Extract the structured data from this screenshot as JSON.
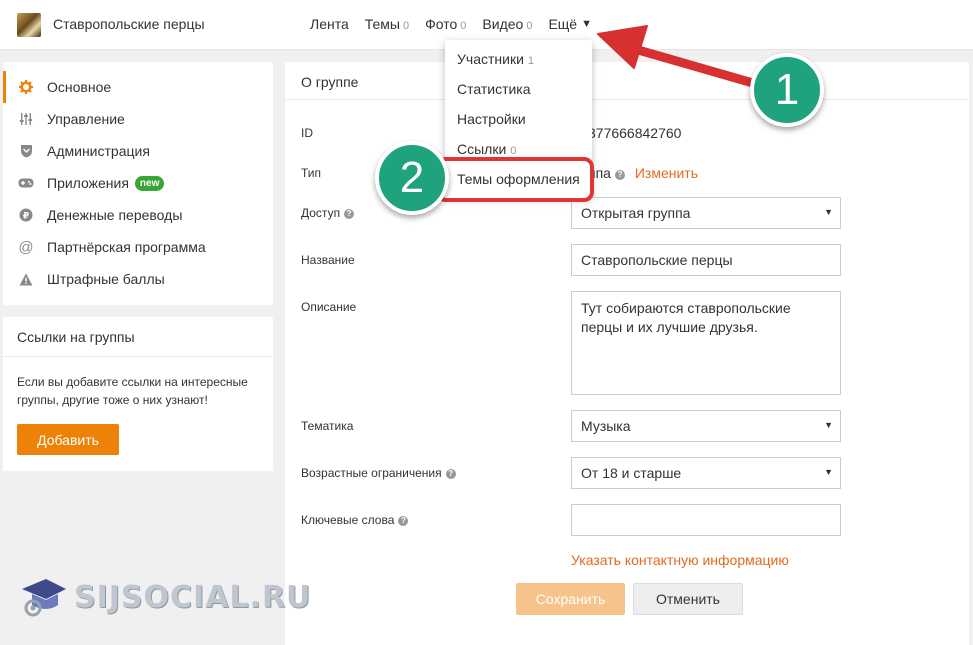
{
  "header": {
    "group_name": "Ставропольские перцы",
    "nav": [
      {
        "label": "Лента",
        "count": ""
      },
      {
        "label": "Темы",
        "count": "0"
      },
      {
        "label": "Фото",
        "count": "0"
      },
      {
        "label": "Видео",
        "count": "0"
      }
    ],
    "more_label": "Ещё",
    "more_icon": "triangle-down-icon"
  },
  "dropdown": {
    "items": [
      {
        "label": "Участники",
        "count": "1"
      },
      {
        "label": "Статистика",
        "count": ""
      },
      {
        "label": "Настройки",
        "count": ""
      },
      {
        "label": "Ссылки",
        "count": "0"
      },
      {
        "label": "Темы оформления",
        "count": ""
      }
    ]
  },
  "sidebar": {
    "items": [
      {
        "label": "Основное",
        "icon": "gear-icon",
        "active": true
      },
      {
        "label": "Управление",
        "icon": "sliders-icon"
      },
      {
        "label": "Администрация",
        "icon": "shield-icon"
      },
      {
        "label": "Приложения",
        "icon": "gamepad-icon",
        "badge": "new"
      },
      {
        "label": "Денежные переводы",
        "icon": "ruble-icon"
      },
      {
        "label": "Партнёрская программа",
        "icon": "at-icon"
      },
      {
        "label": "Штрафные баллы",
        "icon": "warning-icon"
      }
    ],
    "accent_color": "#ee8208",
    "badge_color": "#3aa537"
  },
  "links_card": {
    "title": "Ссылки на группы",
    "description": "Если вы добавите ссылки на интересные группы, другие тоже о них узнают!",
    "add_button": "Добавить"
  },
  "main": {
    "title": "О группе",
    "id_label": "ID",
    "id_value": "377666842760",
    "type_label": "Тип",
    "type_value": "ппа",
    "type_change": "Изменить",
    "access_label": "Доступ",
    "access_value": "Открытая группа",
    "name_label": "Название",
    "name_value": "Ставропольские перцы",
    "desc_label": "Описание",
    "desc_value": "Тут собираются ставропольские перцы и их лучшие друзья.",
    "topic_label": "Тематика",
    "topic_value": "Музыка",
    "age_label": "Возрастные ограничения",
    "age_value": "От 18 и старше",
    "keywords_label": "Ключевые слова",
    "keywords_value": "",
    "contact_link": "Указать контактную информацию",
    "save_button": "Сохранить",
    "cancel_button": "Отменить"
  },
  "annotations": {
    "step1": "1",
    "step2": "2",
    "arrow_color": "#e03535",
    "circle_color": "#1fa37f"
  },
  "watermark": "SIJSOCIAL.RU"
}
